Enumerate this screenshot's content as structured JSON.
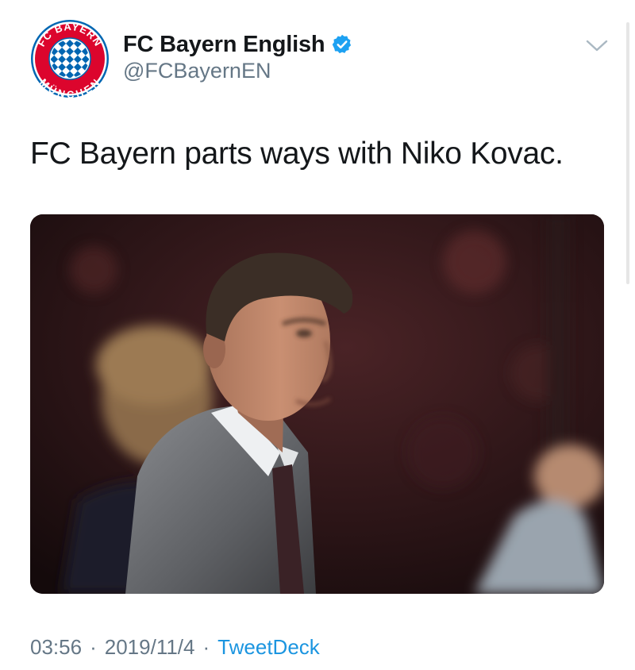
{
  "tweet": {
    "author": {
      "display_name": "FC Bayern English",
      "handle": "@FCBayernEN",
      "verified_icon": "verified-badge-icon",
      "avatar": {
        "icon": "fc-bayern-crest",
        "top_text": "FC BAYERN",
        "bottom_text": "MÜNCHEN",
        "colors": {
          "red": "#dc052d",
          "blue": "#0066b2",
          "white": "#ffffff"
        }
      }
    },
    "menu_icon": "chevron-down-icon",
    "text": "FC Bayern parts ways with Niko Kovac.",
    "media": {
      "type": "photo"
    },
    "footer": {
      "time": "03:56",
      "separator": "·",
      "date": "2019/11/4",
      "source": "TweetDeck"
    },
    "colors": {
      "text": "#14171a",
      "secondary": "#657786",
      "link": "#1b95e0",
      "verified": "#1da1f2"
    }
  }
}
